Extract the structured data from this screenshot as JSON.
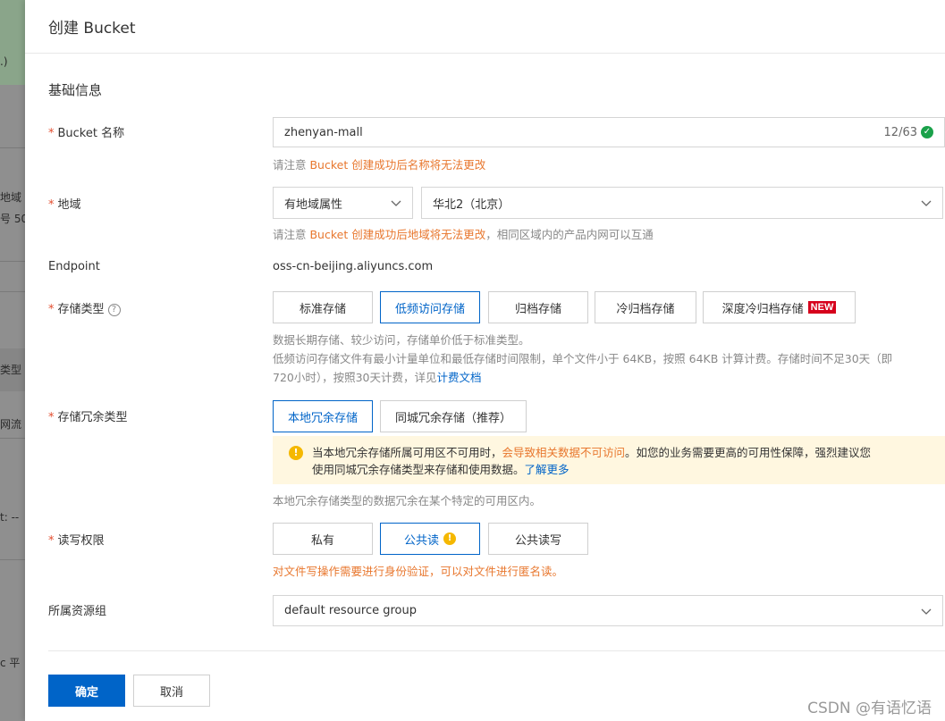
{
  "background": {
    "fragments": [
      ".)",
      "地域",
      "号 50",
      "类型",
      "网流",
      "t: --",
      "c 平"
    ]
  },
  "drawer": {
    "title": "创建 Bucket",
    "section_title": "基础信息"
  },
  "bucket_name": {
    "required": "*",
    "label": "Bucket 名称",
    "value": "zhenyan-mall",
    "counter": "12/63",
    "hint_prefix": "请注意 ",
    "hint_highlight": "Bucket 创建成功后名称将无法更改"
  },
  "region": {
    "required": "*",
    "label": "地域",
    "attribute_select": "有地域属性",
    "region_select": "华北2（北京）",
    "hint_prefix": "请注意 ",
    "hint_highlight": "Bucket 创建成功后地域将无法更改",
    "hint_suffix": "，相同区域内的产品内网可以互通"
  },
  "endpoint": {
    "label": "Endpoint",
    "value": "oss-cn-beijing.aliyuncs.com"
  },
  "storage_class": {
    "required": "*",
    "label": "存储类型",
    "options": [
      "标准存储",
      "低频访问存储",
      "归档存储",
      "冷归档存储",
      "深度冷归档存储"
    ],
    "selected": "低频访问存储",
    "new_badge": "NEW",
    "hint_line1": "数据长期存储、较少访问，存储单价低于标准类型。",
    "hint_line2": "低频访问存储文件有最小计量单位和最低存储时间限制，单个文件小于 64KB，按照 64KB 计算计费。存储时间不足30天（即",
    "hint_line3_prefix": "720小时），按照30天计费，详见",
    "hint_line3_link": "计费文档"
  },
  "redundancy": {
    "required": "*",
    "label": "存储冗余类型",
    "options": [
      "本地冗余存储",
      "同城冗余存储（推荐）"
    ],
    "selected": "本地冗余存储",
    "alert_prefix": "当本地冗余存储所属可用区不可用时，",
    "alert_highlight": "会导致相关数据不可访问",
    "alert_middle": "。如您的业务需要更高的可用性保障，强烈建议您",
    "alert_line2": "使用同城冗余存储类型来存储和使用数据。",
    "alert_link": "了解更多",
    "hint": "本地冗余存储类型的数据冗余在某个特定的可用区内。"
  },
  "acl": {
    "required": "*",
    "label": "读写权限",
    "options": [
      "私有",
      "公共读",
      "公共读写"
    ],
    "selected": "公共读",
    "warning": "对文件写操作需要进行身份验证，可以对文件进行匿名读。"
  },
  "resource_group": {
    "label": "所属资源组",
    "value": "default resource group"
  },
  "footer": {
    "confirm": "确定",
    "cancel": "取消"
  },
  "watermark": "CSDN @有语忆语",
  "colors": {
    "primary": "#0064c8",
    "warning_text": "#e8772e",
    "required": "#e34d2f",
    "success": "#1aa14a",
    "new_badge": "#d6001c",
    "alert_bg": "#fff7e0"
  }
}
